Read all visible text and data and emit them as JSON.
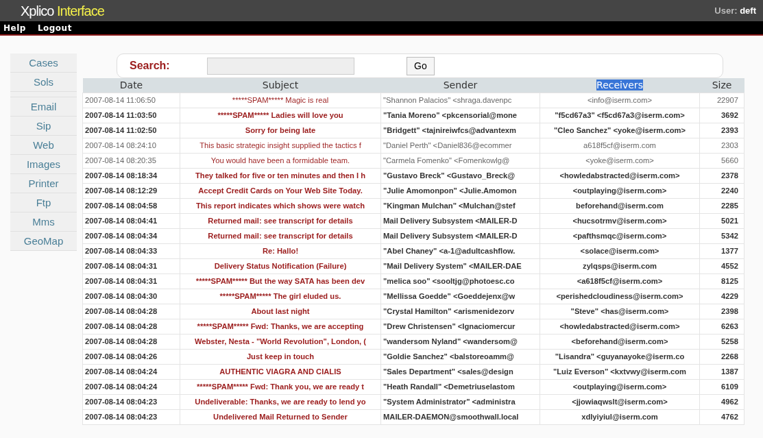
{
  "header": {
    "title": "Xplico",
    "title_accent": "Interface",
    "user_label": "User:",
    "user_name": "deft"
  },
  "menu": [
    "Help",
    "Logout"
  ],
  "sidebar": {
    "groups": [
      [
        "Cases",
        "Sols"
      ],
      [
        "Email",
        "Sip",
        "Web",
        "Images",
        "Printer",
        "Ftp",
        "Mms",
        "GeoMap"
      ]
    ]
  },
  "search": {
    "label": "Search:",
    "button": "Go"
  },
  "table": {
    "columns": [
      {
        "label": "Date",
        "highlighted": false
      },
      {
        "label": "Subject",
        "highlighted": false
      },
      {
        "label": "Sender",
        "highlighted": false
      },
      {
        "label": "Receivers",
        "highlighted": true
      },
      {
        "label": "Size",
        "highlighted": false
      }
    ],
    "rows": [
      {
        "unread": false,
        "cells": [
          "2007-08-14 11:06:50",
          "*****SPAM***** Magic is real",
          "\"Shannon Palacios\" <shraga.davenpc",
          "<info@iserm.com>",
          "22907"
        ]
      },
      {
        "unread": true,
        "cells": [
          "2007-08-14 11:03:50",
          "*****SPAM***** Ladies will love you",
          "\"Tania Moreno\" <pkcensorial@mone",
          "\"f5cd67a3\" <f5cd67a3@iserm.com>",
          "3692"
        ]
      },
      {
        "unread": true,
        "cells": [
          "2007-08-14 11:02:50",
          "Sorry for being late",
          "\"Bridgett\" <tajnireiwfcs@advantexm",
          "\"Cleo Sanchez\" <yoke@iserm.com>",
          "2393"
        ]
      },
      {
        "unread": false,
        "cells": [
          "2007-08-14 08:24:10",
          "This basic strategic insight supplied the tactics f",
          "\"Daniel Perth\" <Daniel836@ecommer",
          "a618f5cf@iserm.com",
          "2303"
        ]
      },
      {
        "unread": false,
        "cells": [
          "2007-08-14 08:20:35",
          "You would have been a formidable team.",
          "\"Carmela Fomenko\" <Fomenkowlg@",
          "<yoke@iserm.com>",
          "5660"
        ]
      },
      {
        "unread": true,
        "cells": [
          "2007-08-14 08:18:34",
          "They talked for five or ten minutes and then I h",
          "\"Gustavo Breck\" <Gustavo_Breck@",
          "<howledabstracted@iserm.com>",
          "2378"
        ]
      },
      {
        "unread": true,
        "cells": [
          "2007-08-14 08:12:29",
          "Accept Credit Cards on Your Web Site Today.",
          "\"Julie Amomonpon\" <Julie.Amomon",
          "<outplaying@iserm.com>",
          "2240"
        ]
      },
      {
        "unread": true,
        "cells": [
          "2007-08-14 08:04:58",
          "This report indicates which shows were watch",
          "\"Kingman Mulchan\" <Mulchan@stef",
          "beforehand@iserm.com",
          "2285"
        ]
      },
      {
        "unread": true,
        "cells": [
          "2007-08-14 08:04:41",
          "Returned mail: see transcript for details",
          "Mail Delivery Subsystem <MAILER-D",
          "<hucsotrmv@iserm.com>",
          "5021"
        ]
      },
      {
        "unread": true,
        "cells": [
          "2007-08-14 08:04:34",
          "Returned mail: see transcript for details",
          "Mail Delivery Subsystem <MAILER-D",
          "<pafthsmqc@iserm.com>",
          "5342"
        ]
      },
      {
        "unread": true,
        "cells": [
          "2007-08-14 08:04:33",
          "Re: Hallo!",
          "\"Abel Chaney\" <a-1@adultcashflow.",
          "<solace@iserm.com>",
          "1377"
        ]
      },
      {
        "unread": true,
        "cells": [
          "2007-08-14 08:04:31",
          "Delivery Status Notification (Failure)",
          "\"Mail Delivery System\" <MAILER-DAE",
          "zylqsps@iserm.com",
          "4552"
        ]
      },
      {
        "unread": true,
        "cells": [
          "2007-08-14 08:04:31",
          "*****SPAM***** But the way SATA has been dev",
          "\"melica soo\" <sooltjg@photoesc.co",
          "<a618f5cf@iserm.com>",
          "8125"
        ]
      },
      {
        "unread": true,
        "cells": [
          "2007-08-14 08:04:30",
          "*****SPAM***** The girl eluded us.",
          "\"Mellissa Goedde\" <Goeddejenx@w",
          "<perishedcloudiness@iserm.com>",
          "4229"
        ]
      },
      {
        "unread": true,
        "cells": [
          "2007-08-14 08:04:28",
          "About last night",
          "\"Crystal Hamilton\" <arismenidezorv",
          "\"Steve\" <has@iserm.com>",
          "2398"
        ]
      },
      {
        "unread": true,
        "cells": [
          "2007-08-14 08:04:28",
          "*****SPAM***** Fwd: Thanks, we are accepting",
          "\"Drew Christensen\" <Ignaciomercur",
          "<howledabstracted@iserm.com>",
          "6263"
        ]
      },
      {
        "unread": true,
        "cells": [
          "2007-08-14 08:04:28",
          "Webster, Nesta - \"World Revolution\", London, (",
          "\"wandersom Nyland\" <wandersom@",
          "<beforehand@iserm.com>",
          "5258"
        ]
      },
      {
        "unread": true,
        "cells": [
          "2007-08-14 08:04:26",
          "Just keep in touch",
          "\"Goldie Sanchez\" <balstoreoamm@",
          "\"Lisandra\" <guyanayoke@iserm.co",
          "2268"
        ]
      },
      {
        "unread": true,
        "cells": [
          "2007-08-14 08:04:24",
          "AUTHENTIC VIAGRA AND CIALIS",
          "\"Sales Department\" <sales@design",
          "\"Luiz Everson\" <kxtvwy@iserm.com",
          "1387"
        ]
      },
      {
        "unread": true,
        "cells": [
          "2007-08-14 08:04:24",
          "*****SPAM***** Fwd: Thank you, we are ready t",
          "\"Heath Randall\" <Demetriuselastom",
          "<outplaying@iserm.com>",
          "6109"
        ]
      },
      {
        "unread": true,
        "cells": [
          "2007-08-14 08:04:23",
          "Undeliverable: Thanks, we are ready to lend yo",
          "\"System Administrator\" <administra",
          "<jjowiaqwslt@iserm.com>",
          "4962"
        ]
      },
      {
        "unread": true,
        "cells": [
          "2007-08-14 08:04:23",
          "Undelivered Mail Returned to Sender",
          "MAILER-DAEMON@smoothwall.local",
          "xdlyiyiul@iserm.com",
          "4762"
        ]
      }
    ]
  }
}
